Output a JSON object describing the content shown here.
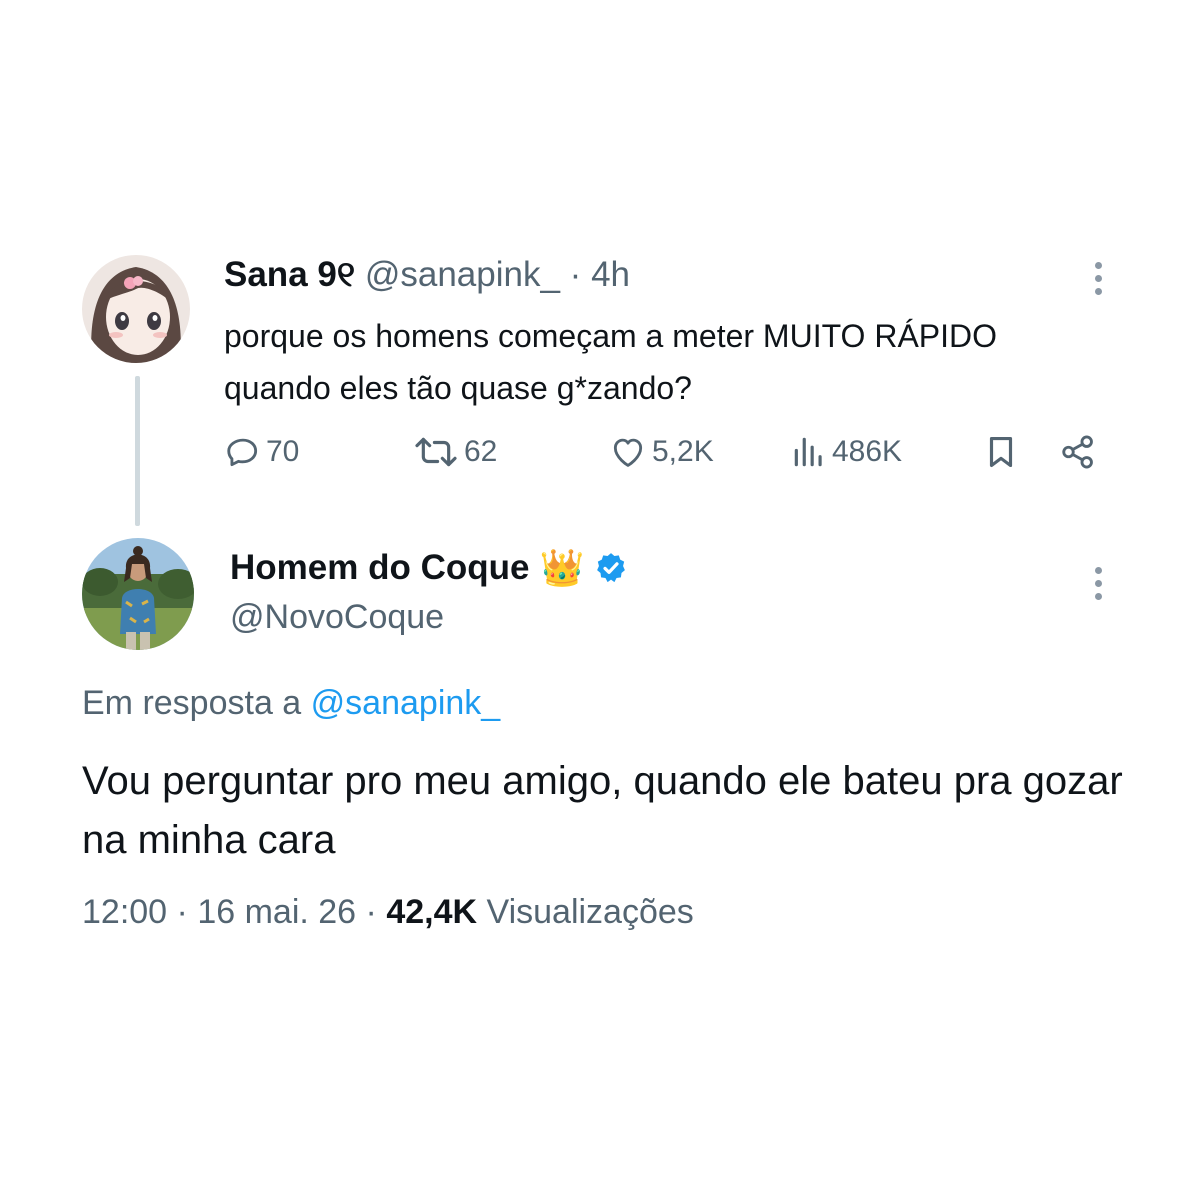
{
  "parent_tweet": {
    "author_name": "Sana 9୧",
    "handle": "@sanapink_",
    "separator": "·",
    "time": "4h",
    "text": "porque os homens começam a meter MUITO RÁPIDO quando eles tão quase g*zando?",
    "actions": {
      "replies": "70",
      "retweets": "62",
      "likes": "5,2K",
      "views": "486K"
    }
  },
  "reply_tweet": {
    "author_name": "Homem do Coque",
    "emoji": "👑",
    "handle": "@NovoCoque",
    "reply_prefix": "Em resposta a",
    "reply_handle": "@sanapink_",
    "text": "Vou perguntar pro meu amigo, quando ele bateu pra gozar na minha cara",
    "time": "12:00",
    "date": "16 mai. 26",
    "separator": "·",
    "views_count": "42,4K",
    "views_label": "Visualizações"
  },
  "colors": {
    "text": "#0f1419",
    "muted": "#536471",
    "link": "#1d9bf0",
    "verified": "#1d9bf0",
    "thread_line": "#cfd9de"
  },
  "icons": [
    "reply-icon",
    "retweet-icon",
    "like-icon",
    "views-icon",
    "bookmark-icon",
    "share-icon",
    "more-icon",
    "verified-badge-icon"
  ]
}
